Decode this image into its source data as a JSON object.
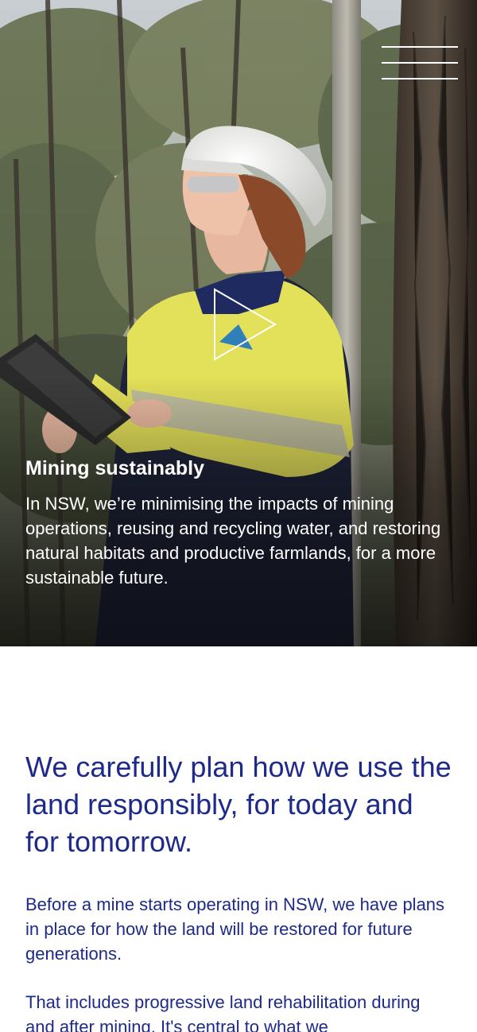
{
  "nav": {
    "menu_icon": "hamburger-menu-icon"
  },
  "hero": {
    "play_icon": "play-icon",
    "title": "Mining sustainably",
    "description": "In NSW, we’re minimising the impacts of mining operations, reusing and recycling water, and restoring natural habitats and productive farmlands, for a more sustainable future."
  },
  "main": {
    "headline": "We carefully plan how we use the land responsibly, for today and for tomorrow.",
    "paragraphs": [
      "Before a mine starts operating in NSW, we have plans in place for how the land will be restored for future generations.",
      "That includes progressive land rehabilitation during and after mining. It's central to what we"
    ]
  },
  "colors": {
    "brand_navy": "#1e2a8a",
    "hero_text": "#ffffff",
    "hi_vis_yellow": "#e3e05a"
  }
}
